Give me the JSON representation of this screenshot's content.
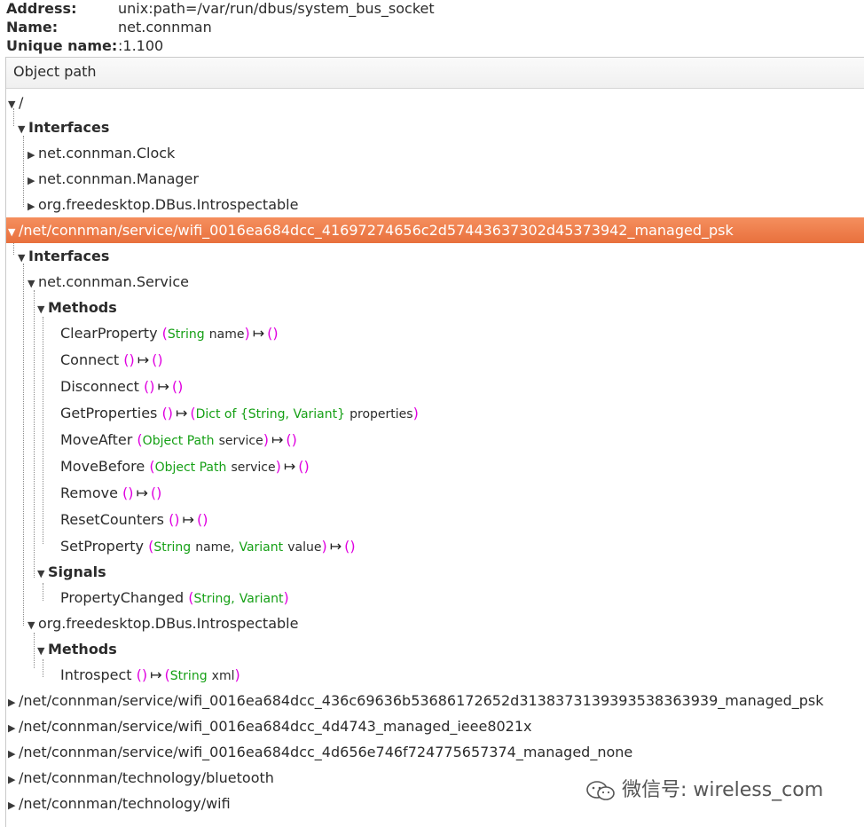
{
  "header": {
    "address_label": "Address:",
    "address_value": "unix:path=/var/run/dbus/system_bus_socket",
    "name_label": "Name:",
    "name_value": "net.connman",
    "unique_label": "Unique name:",
    "unique_value": ":1.100"
  },
  "column_header": "Object path",
  "tree": {
    "root": "/",
    "interfaces": "Interfaces",
    "clock": "net.connman.Clock",
    "manager": "net.connman.Manager",
    "introspectable": "org.freedesktop.DBus.Introspectable",
    "wifi_psk_path": "/net/connman/service/wifi_0016ea684dcc_41697274656c2d57443637302d45373942_managed_psk",
    "interfaces2": "Interfaces",
    "service": "net.connman.Service",
    "methods": "Methods",
    "m_clear_name": "ClearProperty",
    "m_clear_t1": "String",
    "m_clear_a1": "name",
    "m_connect": "Connect",
    "m_disconnect": "Disconnect",
    "m_getprops": "GetProperties",
    "m_getprops_t": "Dict of {String, Variant}",
    "m_getprops_a": "properties",
    "m_moveafter": "MoveAfter",
    "m_moveafter_t": "Object Path",
    "m_moveafter_a": "service",
    "m_movebefore": "MoveBefore",
    "m_movebefore_t": "Object Path",
    "m_movebefore_a": "service",
    "m_remove": "Remove",
    "m_reset": "ResetCounters",
    "m_setprop": "SetProperty",
    "m_setprop_t1": "String",
    "m_setprop_a1": "name,",
    "m_setprop_t2": "Variant",
    "m_setprop_a2": "value",
    "signals": "Signals",
    "s_propchanged": "PropertyChanged",
    "s_propchanged_t1": "String,",
    "s_propchanged_t2": "Variant",
    "introspectable2": "org.freedesktop.DBus.Introspectable",
    "methods2": "Methods",
    "m_introspect": "Introspect",
    "m_introspect_t": "String",
    "m_introspect_a": "xml",
    "path_2": "/net/connman/service/wifi_0016ea684dcc_436c69636b53686172652d3138373139393538363939_managed_psk",
    "path_3": "/net/connman/service/wifi_0016ea684dcc_4d4743_managed_ieee8021x",
    "path_4": "/net/connman/service/wifi_0016ea684dcc_4d656e746f724775657374_managed_none",
    "path_5": "/net/connman/technology/bluetooth",
    "path_6": "/net/connman/technology/wifi"
  },
  "symbols": {
    "expanded": "▼",
    "collapsed": "▶",
    "maps_to": "↦",
    "lp": "(",
    "rp": ")",
    "empty": "()"
  },
  "watermark": "微信号: wireless_com"
}
